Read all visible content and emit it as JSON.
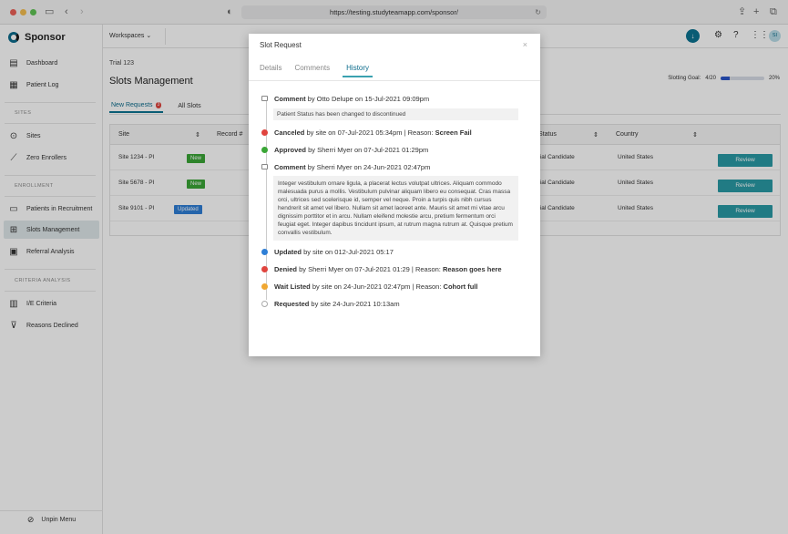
{
  "browser": {
    "url": "https://testing.studyteamapp.com/sponsor/"
  },
  "sidebar": {
    "brand": "Sponsor",
    "items": [
      {
        "label": "Dashboard",
        "icon": "dashboard-icon"
      },
      {
        "label": "Patient Log",
        "icon": "table-icon"
      }
    ],
    "sites_label": "SITES",
    "sites_items": [
      {
        "label": "Sites",
        "icon": "pin-icon"
      },
      {
        "label": "Zero Enrollers",
        "icon": "trend-icon"
      }
    ],
    "enrollment_label": "ENROLLMENT",
    "enrollment_items": [
      {
        "label": "Patients in Recruitment",
        "icon": "card-icon"
      },
      {
        "label": "Slots Management",
        "icon": "slots-icon"
      },
      {
        "label": "Referral Analysis",
        "icon": "report-icon"
      }
    ],
    "criteria_label": "CRITERIA ANALYSIS",
    "criteria_items": [
      {
        "label": "I/E Criteria",
        "icon": "bar-chart-icon"
      },
      {
        "label": "Reasons Declined",
        "icon": "thumbs-down-icon"
      }
    ],
    "unpin": "Unpin Menu"
  },
  "topbar": {
    "workspaces": "Workspaces",
    "avatar": "SI"
  },
  "main": {
    "trial": "Trial 123",
    "title": "Slots Management",
    "goal_label": "Slotting Goal:",
    "goal_value": "4/20",
    "goal_percent": "20%",
    "goal_fraction": 0.2,
    "tabs": [
      {
        "label": "New Requests",
        "badge": "3"
      },
      {
        "label": "All Slots"
      }
    ],
    "columns": [
      "Site",
      "Record #",
      "Status",
      "Country"
    ],
    "rows": [
      {
        "site": "Site 1234 - PI",
        "badge": "New",
        "status": "tial Candidate",
        "country": "United States",
        "action": "Review"
      },
      {
        "site": "Site 5678 - PI",
        "badge": "New",
        "status": "tial Candidate",
        "country": "United States",
        "action": "Review"
      },
      {
        "site": "Site 9101 - PI",
        "badge": "Updated",
        "status": "tial Candidate",
        "country": "United States",
        "action": "Review"
      }
    ]
  },
  "modal": {
    "title": "Slot Request",
    "close": "×",
    "tabs": [
      "Details",
      "Comments",
      "History"
    ],
    "events": [
      {
        "type": "comment",
        "action": "Comment",
        "rest": " by Otto Delupe on 15-Jul-2021 09:09pm",
        "note": "Patient Status has been changed to discontinued"
      },
      {
        "type": "canceled",
        "action": "Canceled",
        "rest": " by site on  07-Jul-2021 05:34pm  |  Reason: ",
        "reason": "Screen Fail"
      },
      {
        "type": "approved",
        "action": "Approved",
        "rest": " by Sherri Myer on 07-Jul-2021 01:29pm"
      },
      {
        "type": "comment",
        "action": "Comment",
        "rest": " by Sherri Myer on 24-Jun-2021 02:47pm",
        "note": "Integer vestibulum ornare ligula, a placerat lectus volutpat ultrices. Aliquam commodo malesuada purus a mollis. Vestibulum pulvinar aliquam libero eu consequat. Cras massa orci, ultrices sed scelerisque id, semper vel neque. Proin a turpis quis nibh cursus hendrerit sit amet vel libero. Nullam sit amet laoreet ante. Mauris sit amet mi vitae arcu dignissim porttitor et in arcu. Nullam eleifend molestie arcu, pretium fermentum orci feugiat eget. Integer dapibus tincidunt ipsum, at rutrum magna rutrum at. Quisque pretium convallis vestibulum."
      },
      {
        "type": "updated",
        "action": "Updated",
        "rest": " by site on 012-Jul-2021 05:17"
      },
      {
        "type": "denied",
        "action": "Denied",
        "rest": " by Sherri Myer on 07-Jul-2021 01:29  |  Reason: ",
        "reason": "Reason goes here"
      },
      {
        "type": "waitlisted",
        "action": "Wait Listed",
        "rest": " by site on 24-Jun-2021 02:47pm  |  Reason: ",
        "reason": "Cohort full"
      },
      {
        "type": "requested",
        "action": "Requested",
        "rest": " by site 24-Jun-2021 10:13am"
      }
    ]
  },
  "colors": {
    "accent": "#0c7391",
    "new_badge": "#3aa636",
    "updated_badge": "#2f7fd6",
    "review_button": "#2a9aa5",
    "canceled": "#e0443e",
    "approved": "#3aa636",
    "updated": "#2f7fd6",
    "waitlisted": "#f0a732"
  }
}
